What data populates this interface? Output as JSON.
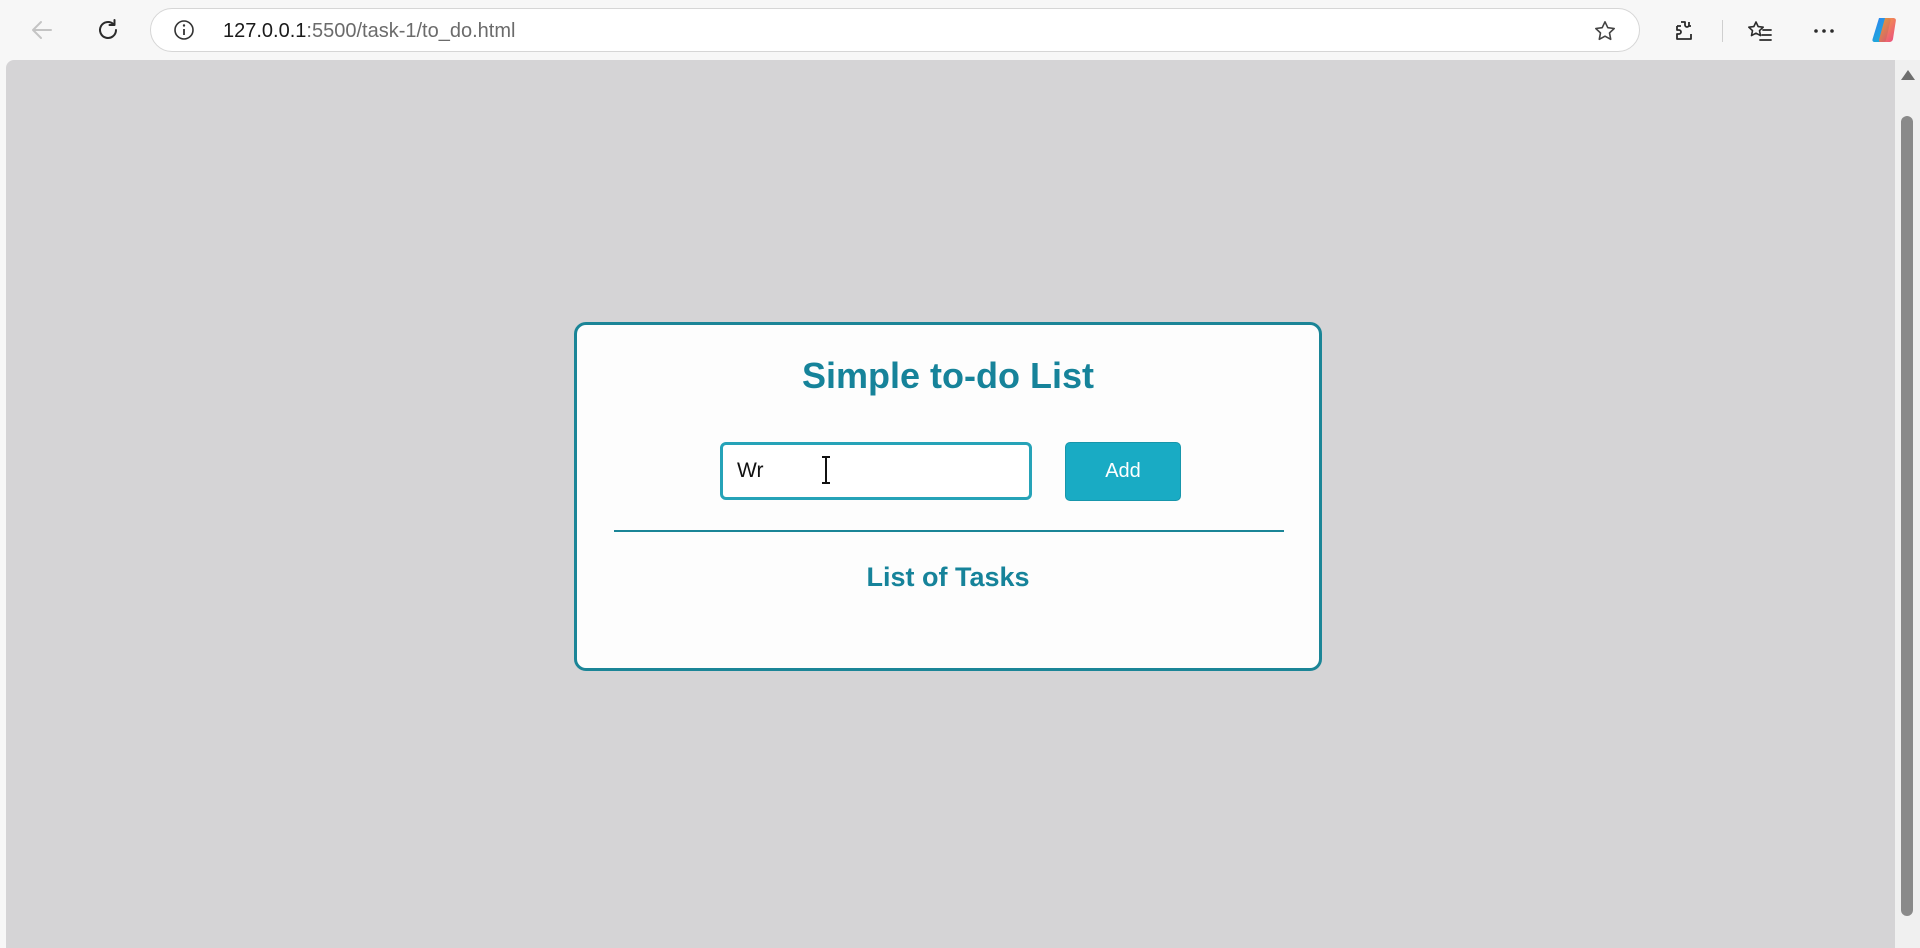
{
  "browser": {
    "url_host": "127.0.0.1",
    "url_rest": ":5500/task-1/to_do.html"
  },
  "app": {
    "title": "Simple to-do List",
    "task_input_value": "Wr",
    "add_button_label": "Add",
    "list_heading": "List of Tasks"
  },
  "colors": {
    "accent": "#16839a",
    "button": "#19abc4",
    "page_background": "#d5d4d6"
  }
}
